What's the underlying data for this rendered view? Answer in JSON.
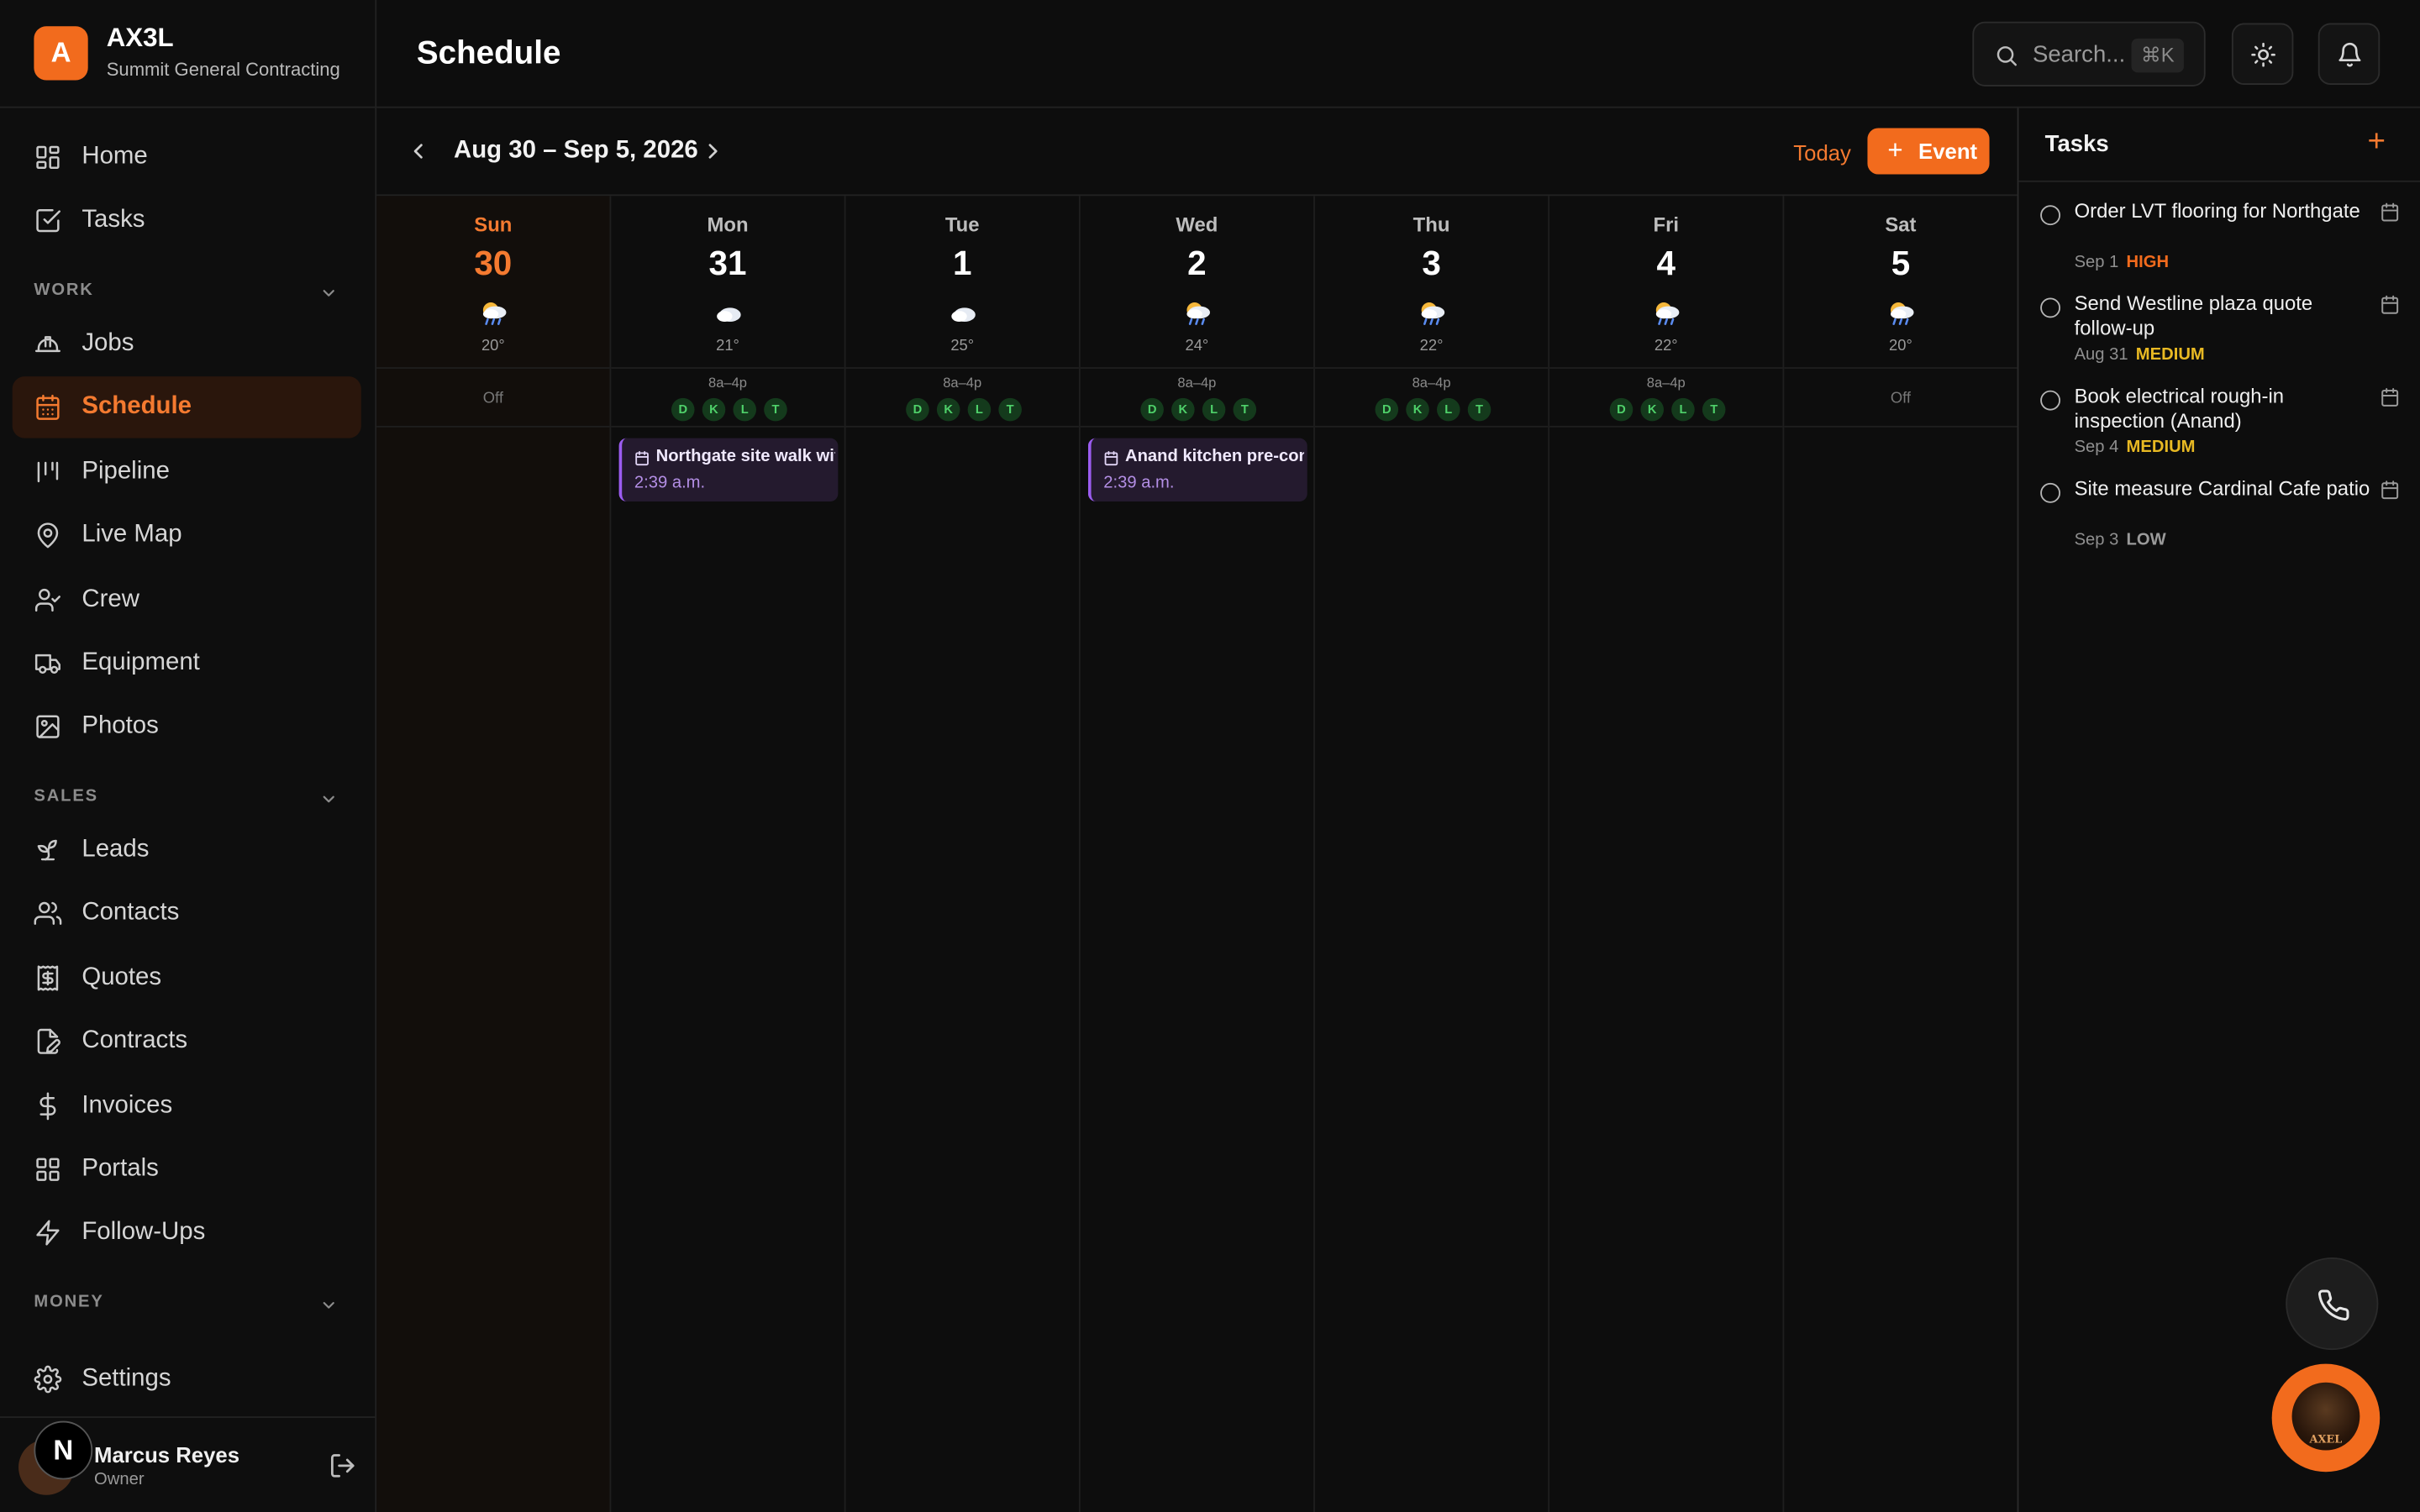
{
  "brand": {
    "logo_letter": "A",
    "name": "AX3L",
    "company": "Summit General Contracting"
  },
  "sidebar": {
    "top_items": [
      {
        "label": "Home",
        "icon": "grid-icon"
      },
      {
        "label": "Tasks",
        "icon": "checkbox-icon"
      }
    ],
    "sections": [
      {
        "label": "WORK",
        "items": [
          {
            "label": "Jobs",
            "icon": "hardhat-icon"
          },
          {
            "label": "Schedule",
            "icon": "calendar-icon",
            "active": true
          },
          {
            "label": "Pipeline",
            "icon": "pipeline-icon"
          },
          {
            "label": "Live Map",
            "icon": "map-pin-icon"
          },
          {
            "label": "Crew",
            "icon": "user-check-icon"
          },
          {
            "label": "Equipment",
            "icon": "truck-icon"
          },
          {
            "label": "Photos",
            "icon": "image-icon"
          }
        ]
      },
      {
        "label": "SALES",
        "items": [
          {
            "label": "Leads",
            "icon": "sprout-icon"
          },
          {
            "label": "Contacts",
            "icon": "users-icon"
          },
          {
            "label": "Quotes",
            "icon": "receipt-icon"
          },
          {
            "label": "Contracts",
            "icon": "file-signature-icon"
          },
          {
            "label": "Invoices",
            "icon": "dollar-icon"
          },
          {
            "label": "Portals",
            "icon": "portal-grid-icon"
          },
          {
            "label": "Follow-Ups",
            "icon": "zap-icon"
          }
        ]
      },
      {
        "label": "MONEY",
        "items": []
      }
    ],
    "settings_label": "Settings",
    "user": {
      "name": "Marcus Reyes",
      "role": "Owner",
      "badge_letter": "N"
    }
  },
  "header": {
    "title": "Schedule",
    "search_placeholder": "Search...",
    "search_shortcut": "⌘K"
  },
  "calendar": {
    "range": "Aug 30 – Sep 5, 2026",
    "today_label": "Today",
    "event_button_label": "Event",
    "days": [
      {
        "name": "Sun",
        "num": "30",
        "temp": "20°",
        "weather": "rain",
        "today": true,
        "off": "Off"
      },
      {
        "name": "Mon",
        "num": "31",
        "temp": "21°",
        "weather": "cloud",
        "hours": "8a–4p",
        "crew": [
          "D",
          "K",
          "L",
          "T"
        ]
      },
      {
        "name": "Tue",
        "num": "1",
        "temp": "25°",
        "weather": "cloud",
        "hours": "8a–4p",
        "crew": [
          "D",
          "K",
          "L",
          "T"
        ]
      },
      {
        "name": "Wed",
        "num": "2",
        "temp": "24°",
        "weather": "rain",
        "hours": "8a–4p",
        "crew": [
          "D",
          "K",
          "L",
          "T"
        ]
      },
      {
        "name": "Thu",
        "num": "3",
        "temp": "22°",
        "weather": "rain",
        "hours": "8a–4p",
        "crew": [
          "D",
          "K",
          "L",
          "T"
        ]
      },
      {
        "name": "Fri",
        "num": "4",
        "temp": "22°",
        "weather": "rain",
        "hours": "8a–4p",
        "crew": [
          "D",
          "K",
          "L",
          "T"
        ]
      },
      {
        "name": "Sat",
        "num": "5",
        "temp": "20°",
        "weather": "rain",
        "off": "Off"
      }
    ],
    "events": [
      {
        "day": 1,
        "title": "Northgate site walk wit",
        "time": "2:39 a.m."
      },
      {
        "day": 3,
        "title": "Anand kitchen pre-con",
        "time": "2:39 a.m."
      }
    ]
  },
  "tasks": {
    "title": "Tasks",
    "items": [
      {
        "title": "Order LVT flooring for Northgate",
        "date": "Sep 1",
        "priority": "HIGH",
        "color": "#f26b1d"
      },
      {
        "title": "Send Westline plaza quote follow-up",
        "date": "Aug 31",
        "priority": "MEDIUM",
        "color": "#e8b923"
      },
      {
        "title": "Book electrical rough-in inspection (Anand)",
        "date": "Sep 4",
        "priority": "MEDIUM",
        "color": "#e8b923"
      },
      {
        "title": "Site measure Cardinal Cafe patio",
        "date": "Sep 3",
        "priority": "LOW",
        "color": "#9a9a9a"
      }
    ]
  },
  "fab": {
    "ai_label": "AXEL"
  },
  "colors": {
    "accent": "#f26b1d",
    "event": "#9b5cf0",
    "crew": "#4fd16a"
  }
}
